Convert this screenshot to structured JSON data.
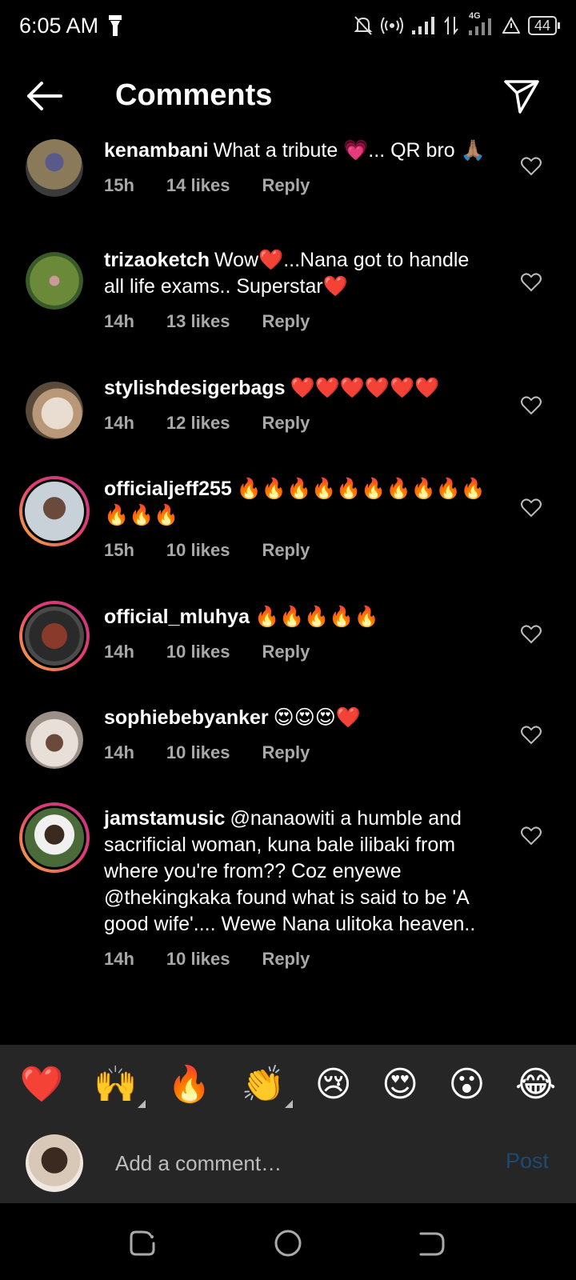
{
  "status_bar": {
    "time": "6:05 AM",
    "network": "4G",
    "battery": "44",
    "icons": [
      "flashlight-icon",
      "mute-icon",
      "hotspot-icon",
      "signal-icon",
      "data-icon",
      "alert-icon",
      "battery-icon"
    ]
  },
  "header": {
    "title": "Comments",
    "back_icon": "back-arrow-icon",
    "share_icon": "send-icon"
  },
  "comments": [
    {
      "username": "kenambani",
      "text": "What a tribute 💗... QR bro 🙏🏽",
      "time": "15h",
      "likes": "14 likes",
      "reply": "Reply",
      "ring": false,
      "avatar_color": "#6b6a52"
    },
    {
      "username": "trizaoketch",
      "text": "Wow❤️...Nana got to handle all life exams.. Superstar❤️",
      "time": "14h",
      "likes": "13 likes",
      "reply": "Reply",
      "ring": false,
      "avatar_color": "#4d6a34"
    },
    {
      "username": "stylishdesigerbags",
      "text": "❤️❤️❤️❤️❤️❤️",
      "time": "14h",
      "likes": "12 likes",
      "reply": "Reply",
      "ring": false,
      "avatar_color": "#c9b8a3"
    },
    {
      "username": "officialjeff255",
      "text": "🔥🔥🔥🔥🔥🔥🔥🔥🔥🔥🔥🔥🔥",
      "time": "15h",
      "likes": "10 likes",
      "reply": "Reply",
      "ring": true,
      "avatar_color": "#9aa8b4"
    },
    {
      "username": "official_mluhya",
      "text": "🔥🔥🔥🔥🔥",
      "time": "14h",
      "likes": "10 likes",
      "reply": "Reply",
      "ring": true,
      "avatar_color": "#5e4a3a"
    },
    {
      "username": "sophiebebyanker",
      "text": "😍😍😍❤️",
      "time": "14h",
      "likes": "10 likes",
      "reply": "Reply",
      "ring": false,
      "avatar_color": "#d8d0c6"
    },
    {
      "username": "jamstamusic",
      "text": "@nanaowiti a humble and sacrificial woman, kuna bale ilibaki from where you're from?? Coz enyewe @thekingkaka found what is said to be 'A good wife'.... Wewe Nana ulitoka heaven..",
      "time": "14h",
      "likes": "10 likes",
      "reply": "Reply",
      "ring": true,
      "avatar_color": "#3d5a3a"
    }
  ],
  "reactions": [
    "❤️",
    "🙌",
    "🔥",
    "👏",
    "😢",
    "😍",
    "😮",
    "😂"
  ],
  "compose": {
    "placeholder": "Add a comment…",
    "post_label": "Post"
  },
  "nav": {
    "icons": [
      "recent-apps-icon",
      "home-icon",
      "back-icon"
    ]
  }
}
